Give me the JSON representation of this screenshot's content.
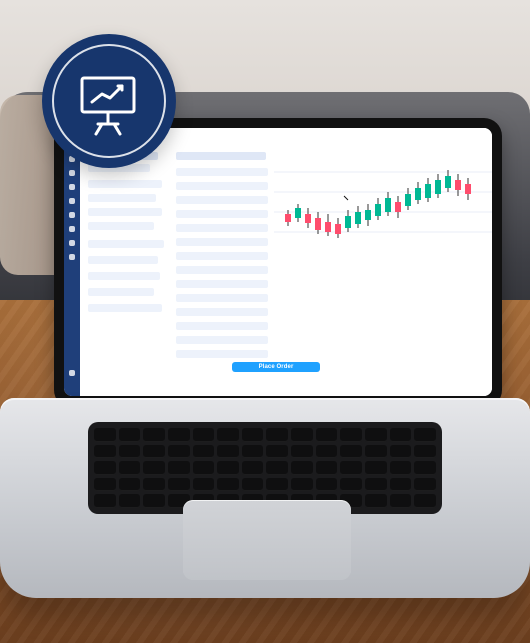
{
  "ui": {
    "place_order_button_label": "Place Order"
  },
  "icons": {
    "presentation_chart": "presentation-chart-icon"
  },
  "colors": {
    "badge_blue": "#17366d",
    "ui_blue": "#1fa1ff",
    "ui_navy": "#1f3f7a"
  }
}
